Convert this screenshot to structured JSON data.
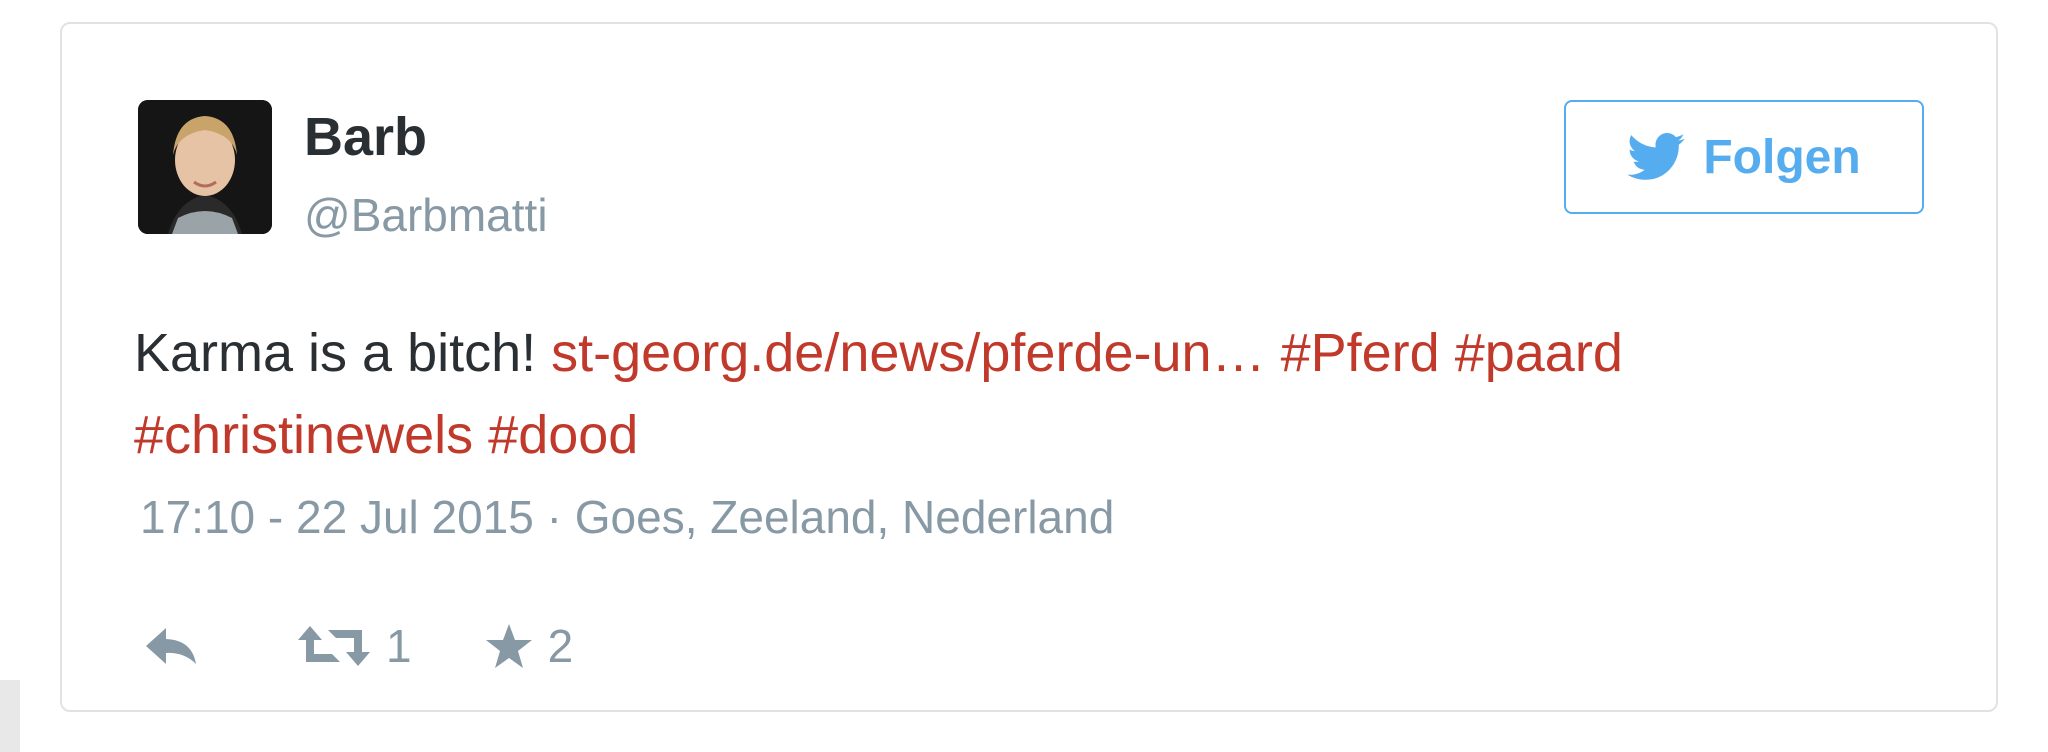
{
  "tweet": {
    "author": {
      "display_name": "Barb",
      "screen_name": "@Barbmatti"
    },
    "follow_button": {
      "label": "Folgen",
      "icon": "twitter-bird-icon"
    },
    "text": {
      "plain": "Karma is a bitch! ",
      "link": "st-georg.de/news/pferde-un…",
      "hashtags": [
        "#Pferd",
        "#paard",
        "#christinewels",
        "#dood"
      ]
    },
    "meta": {
      "time": "17:10 - 22 Jul 2015",
      "separator": "·",
      "location": "Goes, Zeeland, Nederland"
    },
    "actions": {
      "reply_icon": "reply-icon",
      "retweet_icon": "retweet-icon",
      "retweet_count": "1",
      "favorite_icon": "star-icon",
      "favorite_count": "2"
    },
    "colors": {
      "link": "#c0392b",
      "follow_accent": "#55acee",
      "muted": "#8899a6",
      "text": "#292f33"
    }
  }
}
